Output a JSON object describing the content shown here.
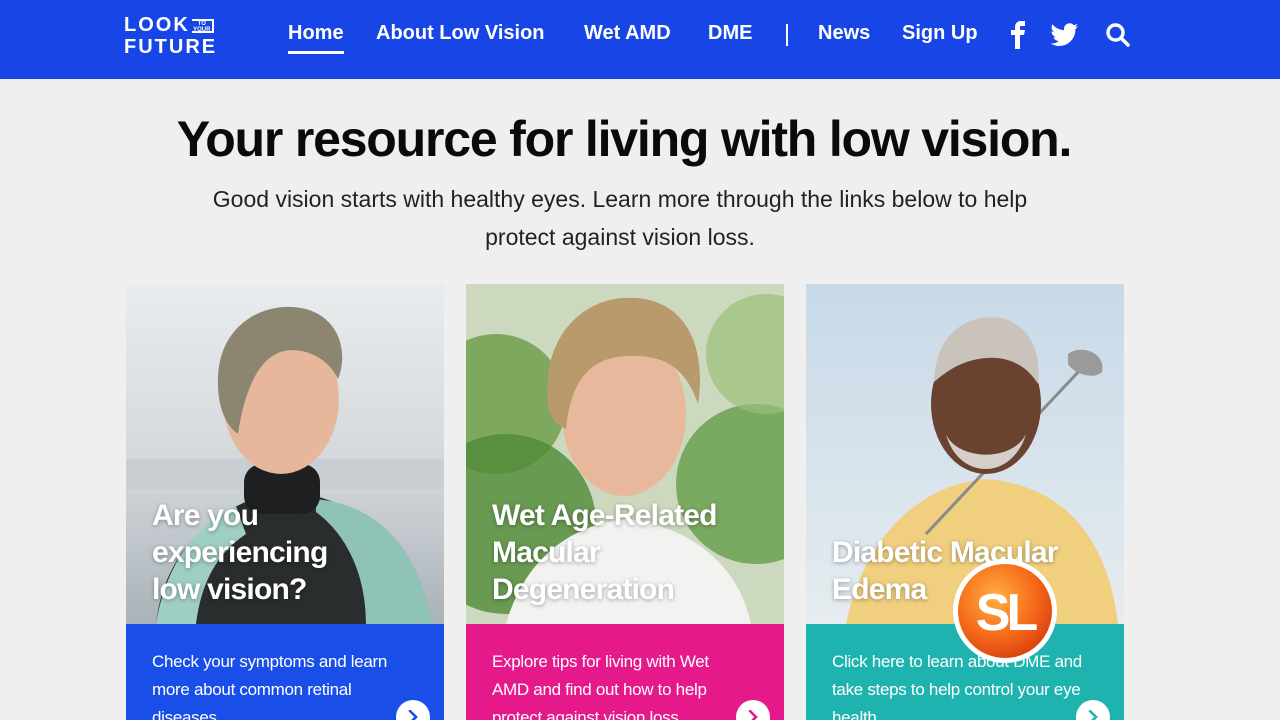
{
  "nav": {
    "logo_top": "LOOK",
    "logo_small": "TO YOUR",
    "logo_bottom": "FUTURE",
    "items": [
      {
        "label": "Home",
        "active": true
      },
      {
        "label": "About Low Vision"
      },
      {
        "label": "Wet AMD"
      },
      {
        "label": "DME"
      },
      {
        "label": "News"
      },
      {
        "label": "Sign Up"
      }
    ],
    "icons": [
      "facebook-icon",
      "twitter-icon",
      "search-icon"
    ]
  },
  "hero": {
    "title": "Your resource for living with low vision.",
    "subtitle": "Good vision starts with healthy eyes. Learn more through the links below to help protect against vision loss."
  },
  "cards": [
    {
      "title_lines": [
        "Are you",
        "experiencing",
        "low vision?"
      ],
      "text": "Check your symptoms and learn more about common retinal diseases.",
      "color": "#1a4ee8"
    },
    {
      "title_lines": [
        "Wet Age-Related",
        "Macular",
        "Degeneration"
      ],
      "text": "Explore tips for living with Wet AMD and find out how to help protect against vision loss.",
      "color": "#e6198a"
    },
    {
      "title_lines": [
        "Diabetic Macular",
        "Edema"
      ],
      "text": "Click here to learn about DME and take steps to help control your eye health.",
      "color": "#1fb3b0"
    }
  ],
  "badge": {
    "text": "SL"
  },
  "colors": {
    "nav": "#1846e6",
    "background": "#efefef"
  }
}
